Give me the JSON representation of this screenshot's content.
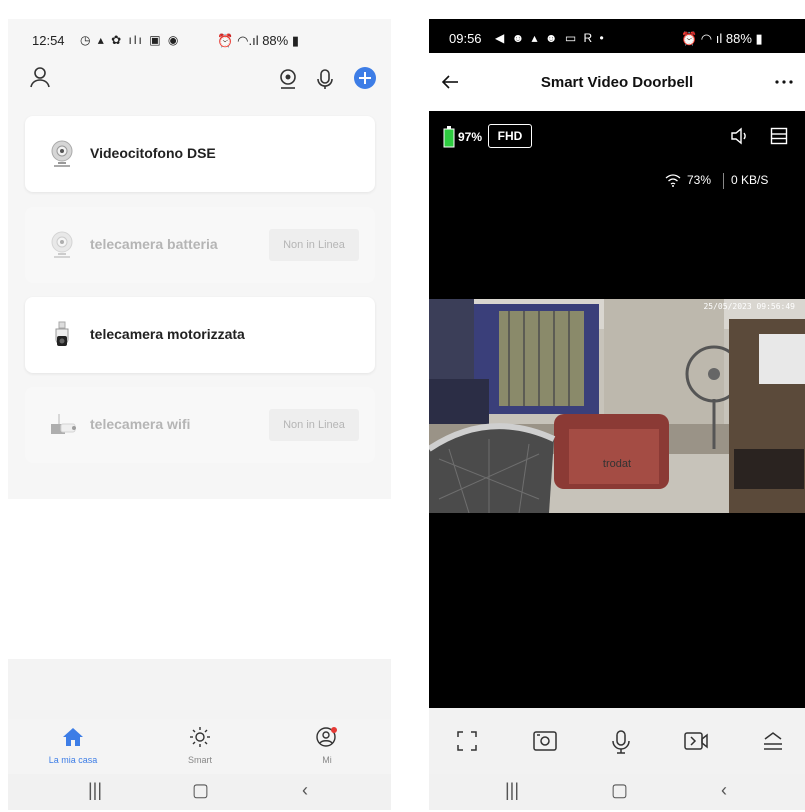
{
  "left": {
    "status": {
      "time": "12:54",
      "battery": "88%"
    },
    "devices": [
      {
        "name": "Videocitofono DSE",
        "icon": "doorbell-camera-icon",
        "offline": false,
        "status": ""
      },
      {
        "name": "telecamera batteria",
        "icon": "battery-camera-icon",
        "offline": true,
        "status": "Non in Linea"
      },
      {
        "name": "telecamera motorizzata",
        "icon": "ptz-camera-icon",
        "offline": false,
        "status": ""
      },
      {
        "name": "telecamera wifi",
        "icon": "wifi-camera-icon",
        "offline": true,
        "status": "Non in Linea"
      }
    ],
    "tabs": [
      {
        "label": "La mia casa",
        "icon": "home-icon"
      },
      {
        "label": "Smart",
        "icon": "sun-icon"
      },
      {
        "label": "Mi",
        "icon": "profile-icon"
      }
    ],
    "accent": "#3d7de6"
  },
  "right": {
    "status": {
      "time": "09:56",
      "battery": "88%"
    },
    "header": {
      "title": "Smart Video Doorbell"
    },
    "battery_percent": "97%",
    "quality": "FHD",
    "wifi_signal": "73%",
    "speed": "0 KB/S",
    "timestamp": "25/05/2023 09:56:49",
    "controls": [
      "fullscreen-icon",
      "screenshot-icon",
      "microphone-icon",
      "record-icon",
      "more-up-icon"
    ]
  }
}
